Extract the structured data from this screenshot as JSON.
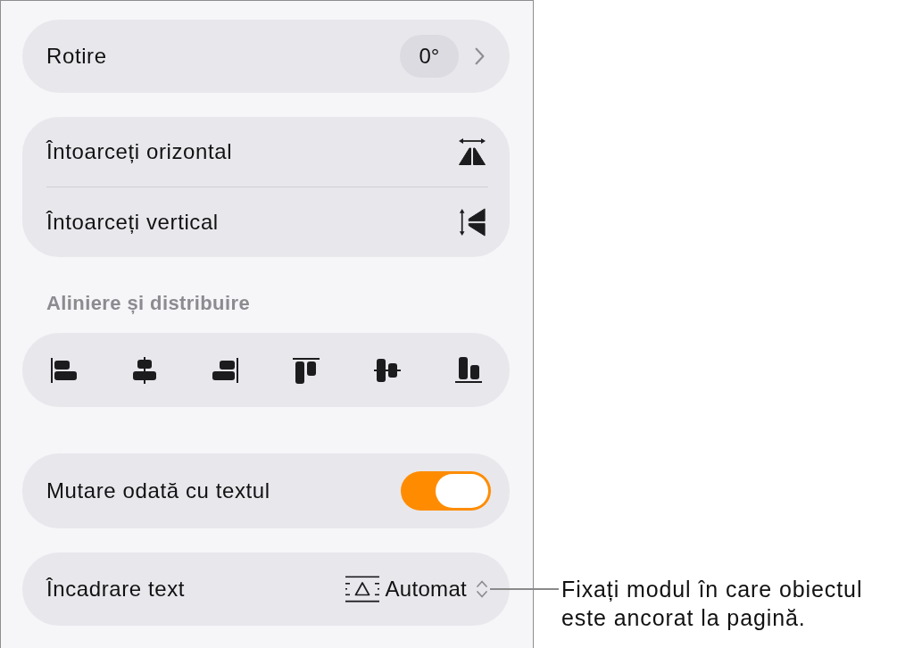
{
  "rotation": {
    "label": "Rotire",
    "value": "0°"
  },
  "flip": [
    {
      "label": "Întoarceți orizontal"
    },
    {
      "label": "Întoarceți vertical"
    }
  ],
  "align_section": {
    "title": "Aliniere și distribuire"
  },
  "move_with_text": {
    "label": "Mutare odată cu textul",
    "on": true
  },
  "text_wrap": {
    "label": "Încadrare text",
    "value": "Automat"
  },
  "callout": {
    "lines": [
      "Fixați modul în care obiectul",
      "este ancorat la pagină."
    ]
  }
}
